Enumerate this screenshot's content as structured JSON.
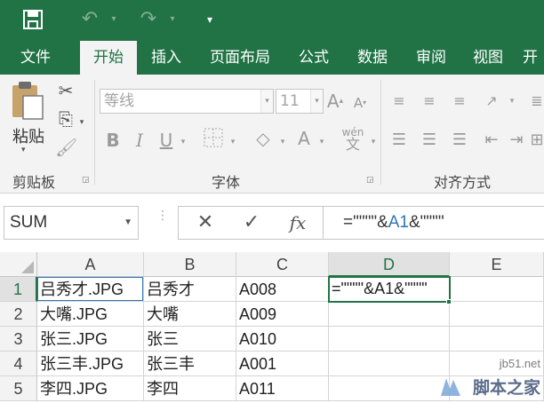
{
  "title_bar": {
    "save_icon": "save-icon",
    "undo_icon": "undo-icon",
    "redo_icon": "redo-icon",
    "customize_icon": "customize-qat-icon"
  },
  "tabs": [
    "文件",
    "开始",
    "插入",
    "页面布局",
    "公式",
    "数据",
    "审阅",
    "视图",
    "开"
  ],
  "active_tab": "开始",
  "ribbon": {
    "clipboard": {
      "paste_label": "粘贴",
      "group_label": "剪贴板"
    },
    "font": {
      "font_name": "等线",
      "font_size": "11",
      "bold": "B",
      "italic": "I",
      "underline": "U",
      "font_color": "A",
      "phonetic": "wén",
      "group_label": "字体"
    },
    "alignment": {
      "group_label": "对齐方式"
    }
  },
  "formula_bar": {
    "name_box": "SUM",
    "formula_parts": [
      "=\"\"\"\"&",
      "A1",
      "&\"\"\"\""
    ],
    "reference_color": "#2e75b6"
  },
  "sheet": {
    "columns": [
      "A",
      "B",
      "C",
      "D",
      "E"
    ],
    "rows": [
      "1",
      "2",
      "3",
      "4",
      "5"
    ],
    "cells": [
      [
        "吕秀才.JPG",
        "吕秀才",
        "A008",
        "=\"\"\"\"&A1&\"\"\"\"",
        ""
      ],
      [
        "大嘴.JPG",
        "大嘴",
        "A009",
        "",
        ""
      ],
      [
        "张三.JPG",
        "张三",
        "A010",
        "",
        ""
      ],
      [
        "张三丰.JPG",
        "张三丰",
        "A001",
        "",
        ""
      ],
      [
        "李四.JPG",
        "李四",
        "A011",
        "",
        ""
      ]
    ],
    "active_cell": "D1"
  },
  "watermark": {
    "site": "jb51.net",
    "brand": "脚本之家"
  },
  "colors": {
    "accent": "#217346",
    "ribbon_bg": "#f3f3f3"
  }
}
